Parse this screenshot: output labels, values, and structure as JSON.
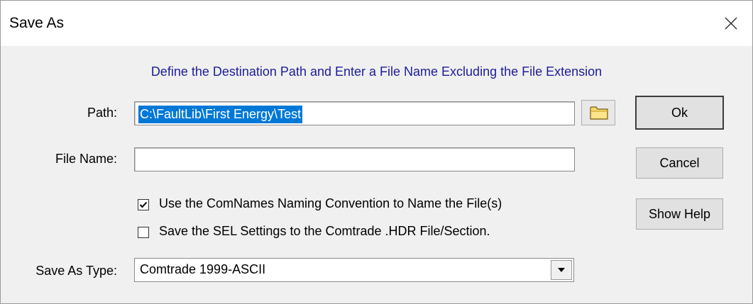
{
  "window": {
    "title": "Save As",
    "close_icon": "close-icon"
  },
  "instruction": "Define the Destination Path and Enter a File Name Excluding the File Extension",
  "path": {
    "label": "Path:",
    "value": "C:\\FaultLib\\First Energy\\Test",
    "selected": true,
    "browse_icon": "folder-icon"
  },
  "file_name": {
    "label": "File Name:",
    "value": ""
  },
  "options": [
    {
      "label": "Use the ComNames Naming Convention to Name the File(s)",
      "checked": true
    },
    {
      "label": "Save the SEL Settings to the Comtrade .HDR File/Section.",
      "checked": false
    }
  ],
  "save_as_type": {
    "label": "Save As Type:",
    "selected": "Comtrade 1999-ASCII"
  },
  "buttons": {
    "ok": "Ok",
    "cancel": "Cancel",
    "help": "Show Help"
  },
  "colors": {
    "instruction_text": "#1d1d9a",
    "selection": "#0078d7",
    "dialog_bg": "#f0f0f0"
  }
}
